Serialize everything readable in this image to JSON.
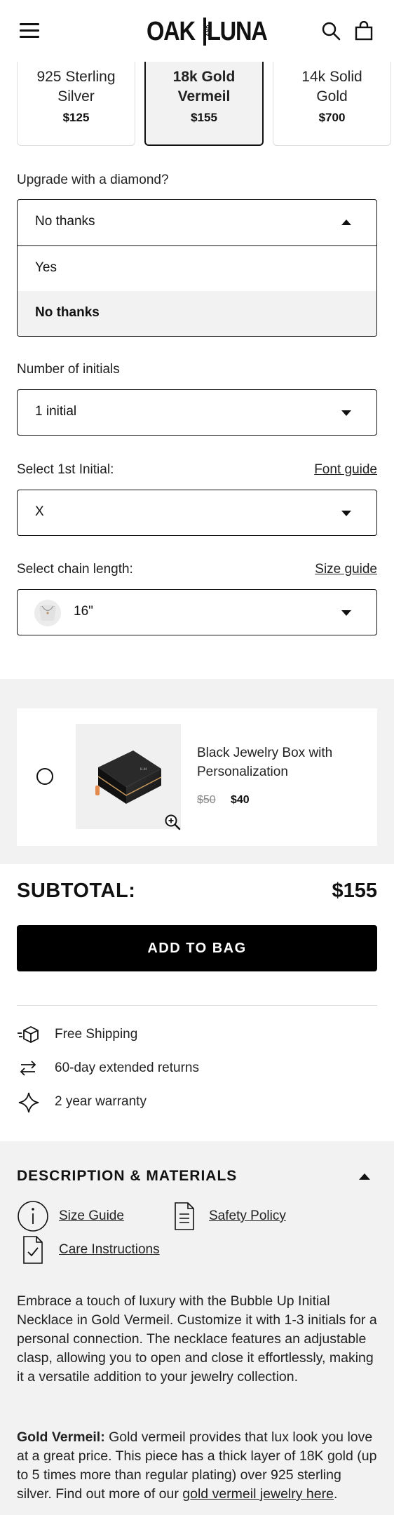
{
  "header": {
    "logo_left": "OAK",
    "logo_mid": "AND",
    "logo_right": "LUNA"
  },
  "metals": [
    {
      "name_line1": "925 Sterling",
      "name_line2": "Silver",
      "price": "$125",
      "selected": false
    },
    {
      "name_line1": "18k Gold",
      "name_line2": "Vermeil",
      "price": "$155",
      "selected": true
    },
    {
      "name_line1": "14k Solid",
      "name_line2": "Gold",
      "price": "$700",
      "selected": false
    }
  ],
  "diamond": {
    "label": "Upgrade with a diamond?",
    "value": "No thanks",
    "options": [
      "Yes",
      "No thanks"
    ]
  },
  "initials_count": {
    "label": "Number of initials",
    "value": "1 initial"
  },
  "first_initial": {
    "label": "Select 1st Initial:",
    "guide_link": "Font guide",
    "value": "X"
  },
  "chain": {
    "label": "Select chain length:",
    "guide_link": "Size guide",
    "value": "16\""
  },
  "upsell": {
    "title": "Black Jewelry Box with Personalization",
    "old_price": "$50",
    "new_price": "$40"
  },
  "subtotal": {
    "label": "SUBTOTAL:",
    "value": "$155"
  },
  "add_to_bag": "ADD TO BAG",
  "perks": [
    "Free Shipping",
    "60-day extended returns",
    "2 year warranty"
  ],
  "description": {
    "title": "DESCRIPTION & MATERIALS",
    "links": {
      "size_guide": "Size Guide",
      "safety_policy": "Safety Policy",
      "care_instructions": "Care Instructions"
    },
    "paragraph1": "Embrace a touch of luxury with the Bubble Up Initial Necklace in Gold Vermeil. Customize it with 1-3 initials for a personal connection. The necklace features an adjustable clasp, allowing you to open and close it effortlessly, making it a versatile addition to your jewelry collection.",
    "p2_bold": "Gold Vermeil:",
    "p2_text": " Gold vermeil provides that lux look you love at a great price. This piece has a thick layer of 18K gold (up to 5 times more than regular plating) over 925 sterling silver. Find out more of our ",
    "p2_link": "gold vermeil jewelry here",
    "p2_end": "."
  }
}
